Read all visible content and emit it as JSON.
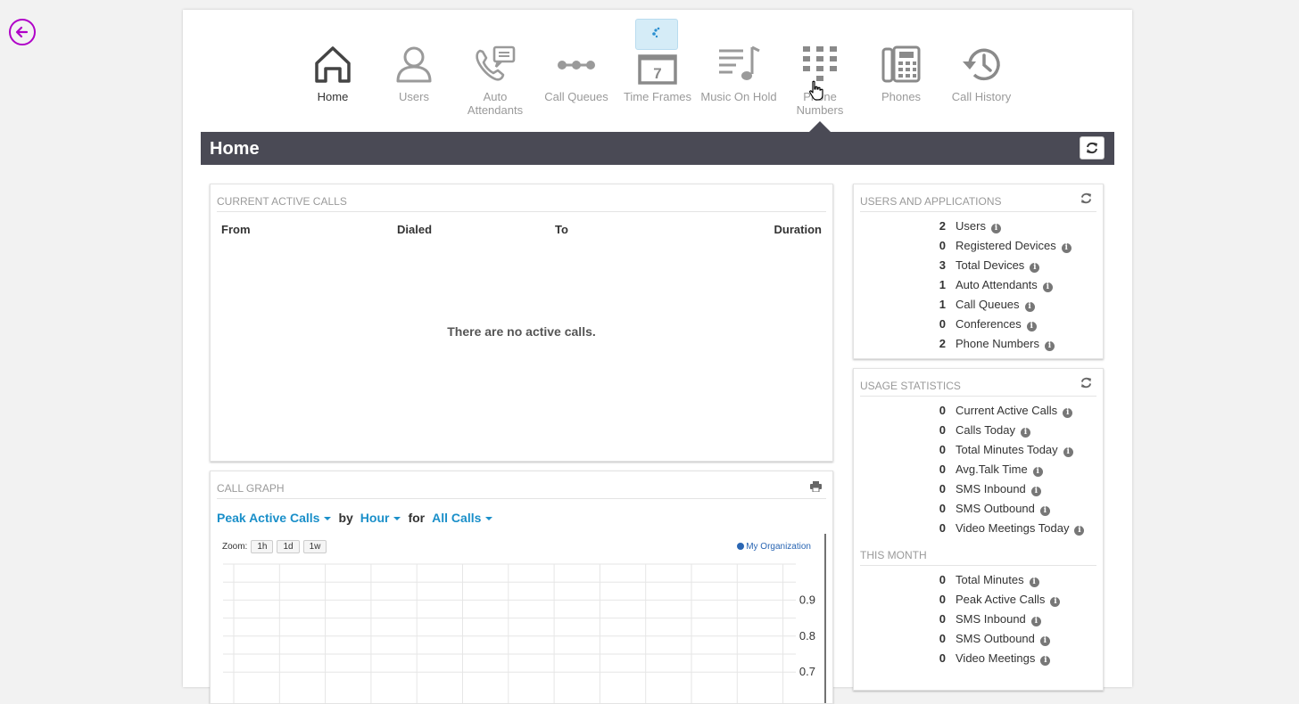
{
  "nav": {
    "items": [
      {
        "label": "Home",
        "icon": "home-icon"
      },
      {
        "label": "Users",
        "icon": "user-icon"
      },
      {
        "label": "Auto Attendants",
        "icon": "auto-attendant-icon"
      },
      {
        "label": "Call Queues",
        "icon": "call-queue-icon"
      },
      {
        "label": "Time Frames",
        "icon": "calendar-icon"
      },
      {
        "label": "Music On Hold",
        "icon": "music-icon"
      },
      {
        "label": "Phone Numbers",
        "icon": "dialpad-icon"
      },
      {
        "label": "Phones",
        "icon": "phone-device-icon"
      },
      {
        "label": "Call History",
        "icon": "history-icon"
      }
    ],
    "calendar_day": "7"
  },
  "header": {
    "title": "Home"
  },
  "active_calls": {
    "title": "Current Active Calls",
    "columns": [
      "From",
      "Dialed",
      "To",
      "Duration"
    ],
    "empty_message": "There are no active calls."
  },
  "call_graph": {
    "title": "Call Graph",
    "metric": "Peak Active Calls",
    "by_label": "by",
    "interval": "Hour",
    "for_label": "for",
    "scope": "All Calls",
    "zoom_label": "Zoom:",
    "zoom_options": [
      "1h",
      "1d",
      "1w"
    ],
    "legend": "My Organization"
  },
  "chart_data": {
    "type": "line",
    "series": [
      {
        "name": "My Organization",
        "values": []
      }
    ],
    "y_ticks": [
      0.9,
      0.8,
      0.7
    ],
    "grid": true,
    "legend_position": "top-right"
  },
  "users_apps": {
    "title": "Users and Applications",
    "rows": [
      {
        "value": "2",
        "label": "Users"
      },
      {
        "value": "0",
        "label": "Registered Devices"
      },
      {
        "value": "3",
        "label": "Total Devices"
      },
      {
        "value": "1",
        "label": "Auto Attendants"
      },
      {
        "value": "1",
        "label": "Call Queues"
      },
      {
        "value": "0",
        "label": "Conferences"
      },
      {
        "value": "2",
        "label": "Phone Numbers"
      }
    ]
  },
  "usage": {
    "title": "Usage Statistics",
    "rows": [
      {
        "value": "0",
        "label": "Current Active Calls"
      },
      {
        "value": "0",
        "label": "Calls Today"
      },
      {
        "value": "0",
        "label": "Total Minutes Today"
      },
      {
        "value": "0",
        "label": "Avg.Talk Time"
      },
      {
        "value": "0",
        "label": "SMS Inbound"
      },
      {
        "value": "0",
        "label": "SMS Outbound"
      },
      {
        "value": "0",
        "label": "Video Meetings Today"
      }
    ],
    "month_title": "This Month",
    "month_rows": [
      {
        "value": "0",
        "label": "Total Minutes"
      },
      {
        "value": "0",
        "label": "Peak Active Calls"
      },
      {
        "value": "0",
        "label": "SMS Inbound"
      },
      {
        "value": "0",
        "label": "SMS Outbound"
      },
      {
        "value": "0",
        "label": "Video Meetings"
      }
    ]
  },
  "colors": {
    "accent": "#1a8fc9",
    "header_bg": "#4a4a55",
    "back_button": "#b000c8",
    "legend": "#2a66b3"
  }
}
